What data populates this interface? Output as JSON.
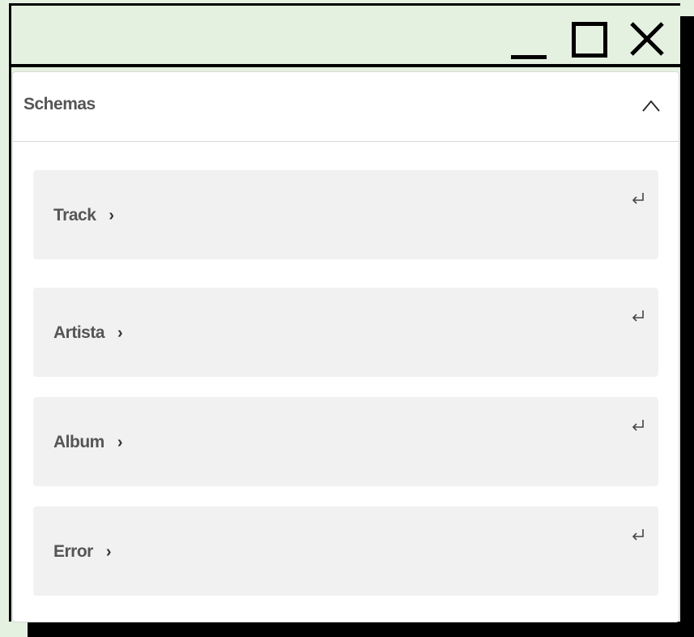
{
  "window": {
    "controls": {
      "minimize": "minimize-icon",
      "maximize": "maximize-icon",
      "close": "close-icon"
    }
  },
  "panel": {
    "title": "Schemas",
    "expanded": true,
    "items": [
      {
        "label": "Track"
      },
      {
        "label": "Artista"
      },
      {
        "label": "Album"
      },
      {
        "label": "Error"
      }
    ]
  },
  "colors": {
    "background": "#e5f1e0",
    "item_background": "#f1f1f1",
    "text": "#555555"
  }
}
